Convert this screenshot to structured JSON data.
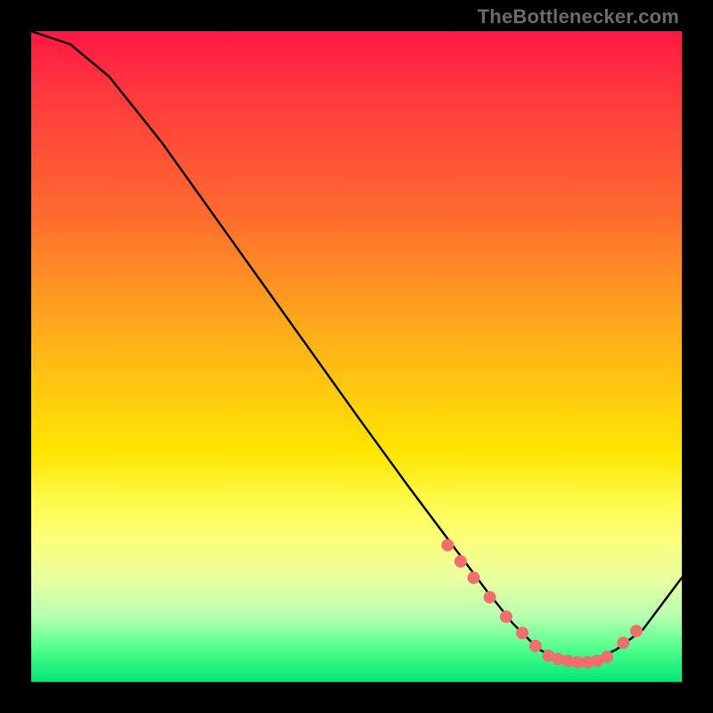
{
  "attribution": "TheBottlenecker.com",
  "chart_data": {
    "type": "line",
    "title": "",
    "xlabel": "",
    "ylabel": "",
    "xlim": [
      0,
      1
    ],
    "ylim": [
      0,
      1
    ],
    "series": [
      {
        "name": "curve",
        "x": [
          0.0,
          0.06,
          0.12,
          0.2,
          0.3,
          0.4,
          0.5,
          0.58,
          0.64,
          0.7,
          0.74,
          0.78,
          0.82,
          0.86,
          0.9,
          0.94,
          1.0
        ],
        "y": [
          1.0,
          0.98,
          0.93,
          0.83,
          0.69,
          0.55,
          0.41,
          0.3,
          0.22,
          0.14,
          0.09,
          0.05,
          0.03,
          0.03,
          0.05,
          0.08,
          0.16
        ]
      }
    ],
    "markers": {
      "color": "#ef6e6e",
      "points_x": [
        0.64,
        0.66,
        0.68,
        0.705,
        0.73,
        0.755,
        0.775,
        0.795,
        0.81,
        0.825,
        0.84,
        0.855,
        0.87,
        0.885,
        0.91,
        0.93
      ],
      "points_y": [
        0.21,
        0.185,
        0.16,
        0.13,
        0.1,
        0.075,
        0.055,
        0.04,
        0.035,
        0.032,
        0.03,
        0.03,
        0.032,
        0.038,
        0.06,
        0.078
      ]
    }
  }
}
